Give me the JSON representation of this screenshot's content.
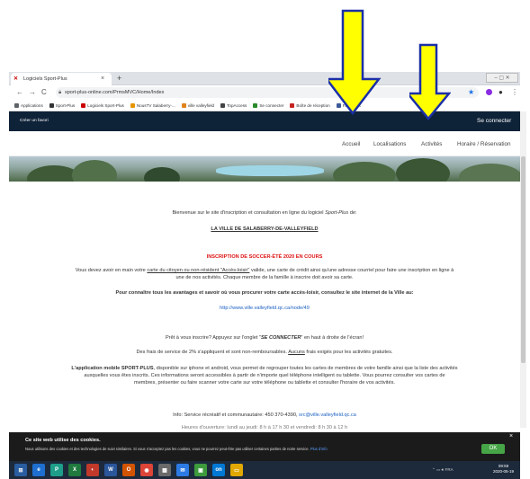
{
  "browser": {
    "tab_title": "Logiciels Sport-Plus",
    "tab_close": "×",
    "new_tab": "+",
    "url": "sport-plus-online.com/PrmsMVC/Home/Index",
    "nav_back": "←",
    "nav_forward": "→",
    "nav_reload": "C",
    "bookmarks": [
      {
        "label": "Applications",
        "color": "#5f6368"
      },
      {
        "label": "Sport-Plus",
        "color": "#333333"
      },
      {
        "label": "Logiciels Sport-Plus",
        "color": "#cc0000"
      },
      {
        "label": "NousTV Salaberry-...",
        "color": "#e69500"
      },
      {
        "label": "ville valleyfield",
        "color": "#e0821b"
      },
      {
        "label": "TopAccess",
        "color": "#444444"
      },
      {
        "label": "Se connecter",
        "color": "#2a8a2a"
      },
      {
        "label": "Boîte de réception",
        "color": "#c5221f"
      },
      {
        "label": "Facebook",
        "color": "#3b5998"
      }
    ]
  },
  "site": {
    "fav_link": "Créer un favori",
    "connect": "Se connecter",
    "nav": [
      "Accueil",
      "Localisations",
      "Activités",
      "Horaire / Réservation"
    ]
  },
  "content": {
    "welcome_a": "Bienvenue sur le site d'inscription et consultation en ligne du logiciel ",
    "welcome_brand": "Sport-Plus",
    "welcome_b": " de:",
    "city": "LA VILLE DE SALABERRY-DE-VALLEYFIELD",
    "soccer": "INSCRIPTION DE SOCCER-ÉTÉ 2020 EN COURS",
    "card_a": "Vous devez avoir en main votre ",
    "card_link": "carte du citoyen ou non-résident \"Accès-loisir\"",
    "card_b": " valide, une carte de crédit ainsi qu'une adresse courriel pour faire une inscription en ligne à",
    "card_line2": "une de nos activités. Chaque membre de la famille à inscrire doit avoir sa carte.",
    "advantages": "Pour connaître tous les avantages et savoir où vous procurer votre carte accès-loisir, consultez le site internet de la Ville au:",
    "city_url": "http://www.ville.valleyfield.qc.ca/node/49",
    "ready_a": "Prêt à vous inscrire? Appuyez sur l'onglet \"",
    "ready_b": "SE CONNECTER",
    "ready_c": "\" en haut à droite de l'écran!",
    "fees_a": "Des frais de service de 2% s'appliquent et sont non-remboursables. ",
    "fees_b": "Aucuns",
    "fees_c": " frais exigés pour les activités gratuites.",
    "app_title": "L'application mobile SPORT-PLUS",
    "app_line1": ", disponible sur iphone et android, vous permet de regrouper toutes les cartes de membres de votre famille ainsi que la liste des activités",
    "app_line2": "auxquelles vous êtes inscrits. Ces informations seront accessibles à partir de n'importe quel téléphone intelligent ou tablette. Vous pourrez consulter vos cartes de",
    "app_line3": "membres, présenter ou faire scanner votre carte sur votre téléphone ou tablette et consulter l'horaire de vos activités.",
    "info_a": "Info: Service récréatif et communautaire: 450 370-4390, ",
    "info_email": "src@ville.valleyfield.qc.ca",
    "hours": "Heures d'ouverture: lundi au jeudi: 8 h à 17 h 30 et vendredi: 8 h 30 à 12 h"
  },
  "cookie": {
    "title": "Ce site web utilise des cookies.",
    "text": "Nous utilisons des cookies et des technologies de suivi similaires. Si vous n'acceptez pas les cookies, vous ne pourrez peut-être pas utiliser certaines parties de notre service. ",
    "more": "Plus d'info",
    "ok": "OK",
    "close": "×"
  },
  "taskbar": {
    "clock_time": "09:59",
    "clock_date": "2020-05-19",
    "icons": [
      {
        "label": "e",
        "color": "#1e6fd0"
      },
      {
        "label": "P",
        "color": "#1e9e8a"
      },
      {
        "label": "X",
        "color": "#1f7a3e"
      },
      {
        "label": "◐",
        "color": "#c0392b"
      },
      {
        "label": "W",
        "color": "#2b579a"
      },
      {
        "label": "O",
        "color": "#d35400"
      },
      {
        "label": "◉",
        "color": "#db4437"
      },
      {
        "label": "▦",
        "color": "#6a6a6a"
      },
      {
        "label": "✉",
        "color": "#2c7be5"
      },
      {
        "label": "▣",
        "color": "#3d9a3d"
      },
      {
        "label": "on",
        "color": "#0078d4"
      },
      {
        "label": "▭",
        "color": "#e0a800"
      }
    ]
  },
  "colors": {
    "header_bg": "#0e2238",
    "arrow": "#ffff00",
    "arrow_outline": "#1a2fa8",
    "accent_red": "#dd1111",
    "ok_green": "#46a546"
  }
}
